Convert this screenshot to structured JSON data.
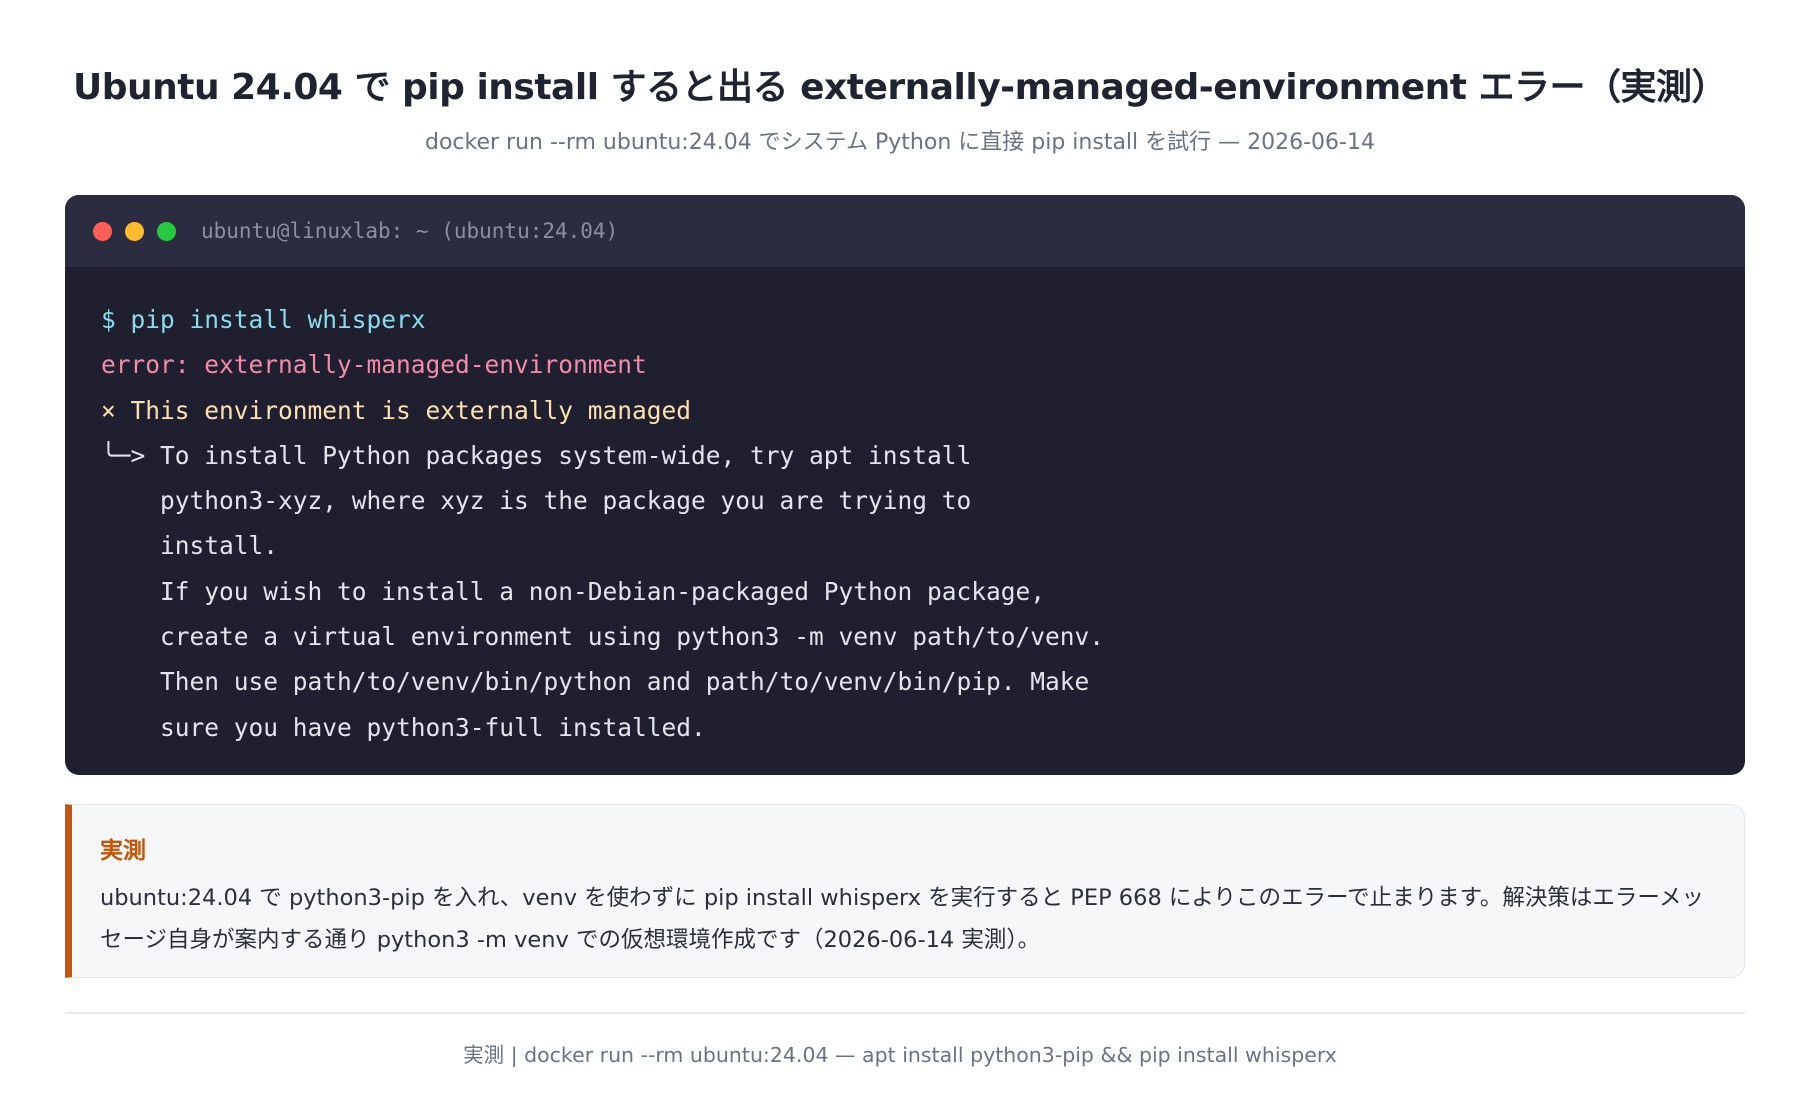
{
  "header": {
    "title": "Ubuntu 24.04 で pip install すると出る externally-managed-environment エラー（実測）",
    "subtitle": "docker run --rm ubuntu:24.04 でシステム Python に直接 pip install を試行 — 2026-06-14"
  },
  "terminal": {
    "window_title": "ubuntu@linuxlab: ~ (ubuntu:24.04)",
    "command": "$ pip install whisperx",
    "error": "error: externally-managed-environment",
    "warning": "× This environment is externally managed",
    "message_lines": [
      "╰─> To install Python packages system-wide, try apt install",
      "    python3-xyz, where xyz is the package you are trying to",
      "    install.",
      "    If you wish to install a non-Debian-packaged Python package,",
      "    create a virtual environment using python3 -m venv path/to/venv.",
      "    Then use path/to/venv/bin/python and path/to/venv/bin/pip. Make",
      "    sure you have python3-full installed."
    ],
    "colors": {
      "red_dot": "#ff5f57",
      "yellow_dot": "#febc2e",
      "green_dot": "#28c840",
      "command": "#89dceb",
      "error": "#f38ba8",
      "warning": "#f9e2af"
    }
  },
  "note": {
    "label": "実測",
    "text": "ubuntu:24.04 で python3-pip を入れ、venv を使わずに pip install whisperx を実行すると PEP 668 によりこのエラーで止まります。解決策はエラーメッセージ自身が案内する通り python3 -m venv での仮想環境作成です（2026-06-14 実測）。",
    "accent_color": "#c2570c"
  },
  "footer": {
    "text": "実測 | docker run --rm ubuntu:24.04 — apt install python3-pip && pip install whisperx"
  }
}
